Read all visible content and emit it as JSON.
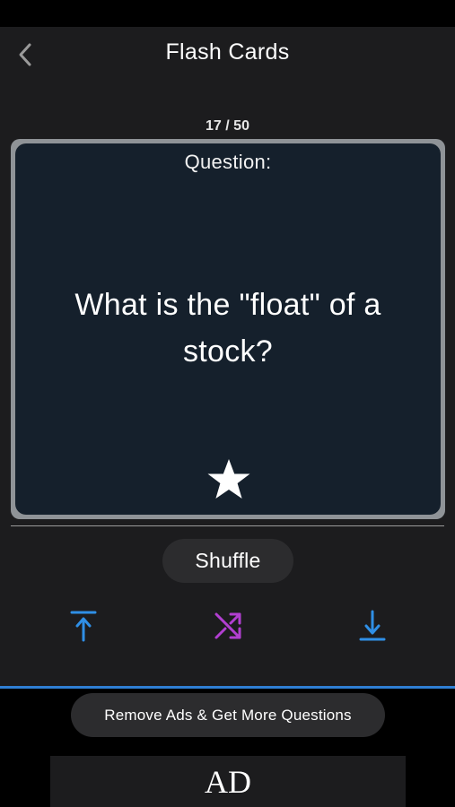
{
  "nav": {
    "title": "Flash Cards",
    "back_icon": "chevron-left-icon"
  },
  "counter": {
    "text": "17 / 50"
  },
  "card": {
    "label": "Question:",
    "question": "What is the \"float\" of a stock?",
    "star_icon": "star-icon",
    "background_color": "#15202c",
    "frame_color": "#8f9397"
  },
  "controls": {
    "shuffle_label": "Shuffle",
    "jump_first_icon": "arrow-up-to-top-icon",
    "shuffle_icon": "shuffle-icon",
    "jump_last_icon": "arrow-down-to-bottom-icon",
    "jump_color": "#2f8fe6",
    "shuffle_color": "#b23fd1"
  },
  "footer": {
    "remove_ads_label": "Remove Ads & Get More Questions",
    "ad_label": "AD",
    "accent_color": "#2f7fd4"
  }
}
